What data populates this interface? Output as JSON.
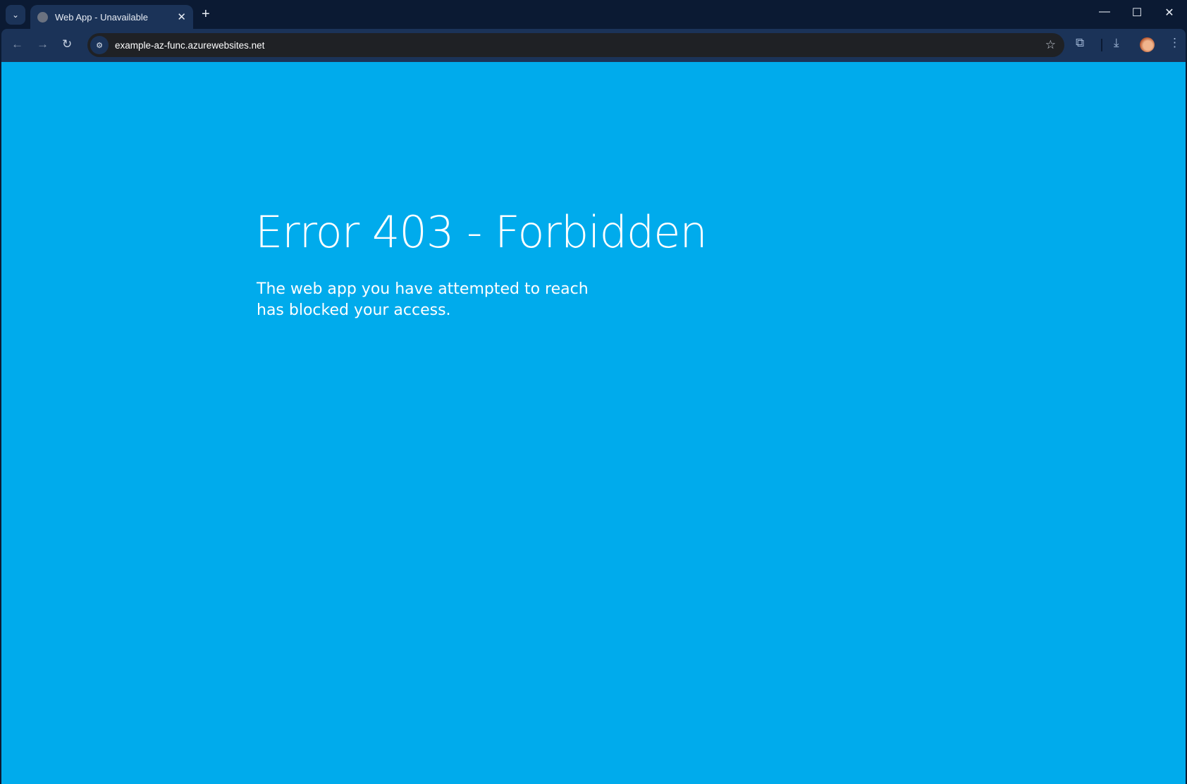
{
  "browser": {
    "tab_title": "Web App - Unavailable",
    "url": "example-az-func.azurewebsites.net",
    "icons": {
      "tab_search": "⌄",
      "close": "✕",
      "new_tab": "+",
      "back": "←",
      "forward": "→",
      "reload": "↻",
      "site_info": "⚙",
      "bookmark": "☆",
      "extensions": "⧉",
      "download": "⤓",
      "menu": "⋮",
      "minimize": "—",
      "maximize": "☐",
      "close_window": "✕"
    }
  },
  "page": {
    "heading": "Error 403 - Forbidden",
    "message": "The web app you have attempted to reach has blocked your access.",
    "background": "#00abec"
  }
}
